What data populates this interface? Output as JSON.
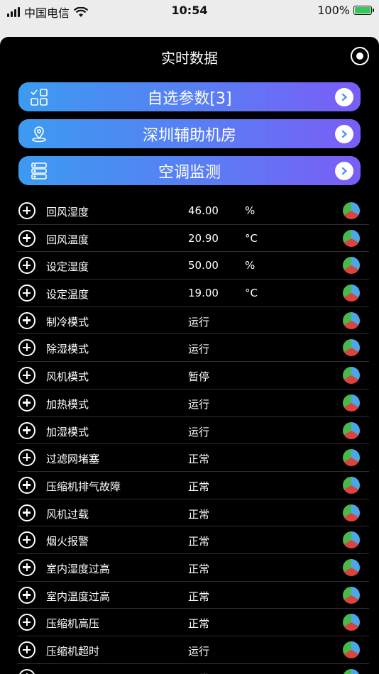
{
  "status_bar": {
    "carrier": "中国电信",
    "time": "10:54",
    "battery": "100%"
  },
  "header": {
    "title": "实时数据"
  },
  "buttons": [
    {
      "label": "自选参数[3]",
      "icon": "checklist-grid-icon"
    },
    {
      "label": "深圳辅助机房",
      "icon": "location-pin-icon"
    },
    {
      "label": "空调监测",
      "icon": "server-stack-icon"
    }
  ],
  "rows": [
    {
      "name": "回风湿度",
      "value": "46.00",
      "unit": "%"
    },
    {
      "name": "回风温度",
      "value": "20.90",
      "unit": "°C"
    },
    {
      "name": "设定湿度",
      "value": "50.00",
      "unit": "%"
    },
    {
      "name": "设定温度",
      "value": "19.00",
      "unit": "°C"
    },
    {
      "name": "制冷模式",
      "value": "运行",
      "unit": ""
    },
    {
      "name": "除湿模式",
      "value": "运行",
      "unit": ""
    },
    {
      "name": "风机模式",
      "value": "暂停",
      "unit": ""
    },
    {
      "name": "加热模式",
      "value": "运行",
      "unit": ""
    },
    {
      "name": "加湿模式",
      "value": "运行",
      "unit": ""
    },
    {
      "name": "过滤网堵塞",
      "value": "正常",
      "unit": ""
    },
    {
      "name": "压缩机排气故障",
      "value": "正常",
      "unit": ""
    },
    {
      "name": "风机过载",
      "value": "正常",
      "unit": ""
    },
    {
      "name": "烟火报警",
      "value": "正常",
      "unit": ""
    },
    {
      "name": "室内湿度过高",
      "value": "正常",
      "unit": ""
    },
    {
      "name": "室内温度过高",
      "value": "正常",
      "unit": ""
    },
    {
      "name": "压缩机高压",
      "value": "正常",
      "unit": ""
    },
    {
      "name": "压缩机超时",
      "value": "运行",
      "unit": ""
    },
    {
      "name": "",
      "value": "正常",
      "unit": ""
    }
  ],
  "colors": {
    "pie_blue": "#4aa8e8",
    "pie_red": "#d9453c",
    "pie_green": "#49b84a",
    "accent_start": "#3c9bf0",
    "accent_end": "#7a5df6"
  }
}
